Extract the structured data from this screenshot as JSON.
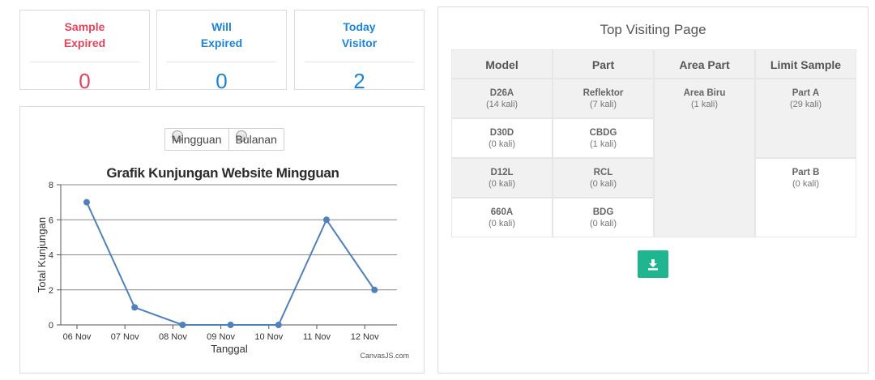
{
  "stats": [
    {
      "title_line1": "Sample",
      "title_line2": "Expired",
      "value": "0",
      "color": "#e2445c"
    },
    {
      "title_line1": "Will",
      "title_line2": "Expired",
      "value": "0",
      "color": "#1c84d6"
    },
    {
      "title_line1": "Today",
      "title_line2": "Visitor",
      "value": "2",
      "color": "#1c84d6"
    }
  ],
  "chart": {
    "toggle_options": [
      "Mingguan",
      "Bulanan"
    ],
    "credit": "CanvasJS.com"
  },
  "chart_data": {
    "type": "line",
    "title": "Grafik Kunjungan Website Mingguan",
    "xlabel": "Tanggal",
    "ylabel": "Total Kunjungan",
    "x_tick_labels": [
      "06 Nov",
      "07 Nov",
      "08 Nov",
      "09 Nov",
      "10 Nov",
      "11 Nov",
      "12 Nov"
    ],
    "y_ticks": [
      0,
      2,
      4,
      6,
      8
    ],
    "ylim": [
      0,
      8
    ],
    "grid": true,
    "line_color": "#4f81bc",
    "series": [
      {
        "x": [
          "06 Nov",
          "07 Nov",
          "08 Nov",
          "09 Nov",
          "10 Nov",
          "11 Nov",
          "12 Nov"
        ],
        "values": [
          7,
          1,
          0,
          0,
          0,
          6,
          2
        ]
      }
    ]
  },
  "top_visiting": {
    "title": "Top Visiting Page",
    "headers": [
      "Model",
      "Part",
      "Area Part",
      "Limit Sample"
    ],
    "model": [
      {
        "name": "D26A",
        "count": "(14 kali)"
      },
      {
        "name": "D30D",
        "count": "(0 kali)"
      },
      {
        "name": "D12L",
        "count": "(0 kali)"
      },
      {
        "name": "660A",
        "count": "(0 kali)"
      }
    ],
    "part": [
      {
        "name": "Reflektor",
        "count": "(7 kali)"
      },
      {
        "name": "CBDG",
        "count": "(1 kali)"
      },
      {
        "name": "RCL",
        "count": "(0 kali)"
      },
      {
        "name": "BDG",
        "count": "(0 kali)"
      }
    ],
    "area_part": [
      {
        "name": "Area Biru",
        "count": "(1 kali)"
      }
    ],
    "limit_sample": [
      {
        "name": "Part A",
        "count": "(29 kali)"
      },
      {
        "name": "Part B",
        "count": "(0 kali)"
      }
    ],
    "download_icon": "download-icon",
    "button_color": "#1fb58f"
  }
}
